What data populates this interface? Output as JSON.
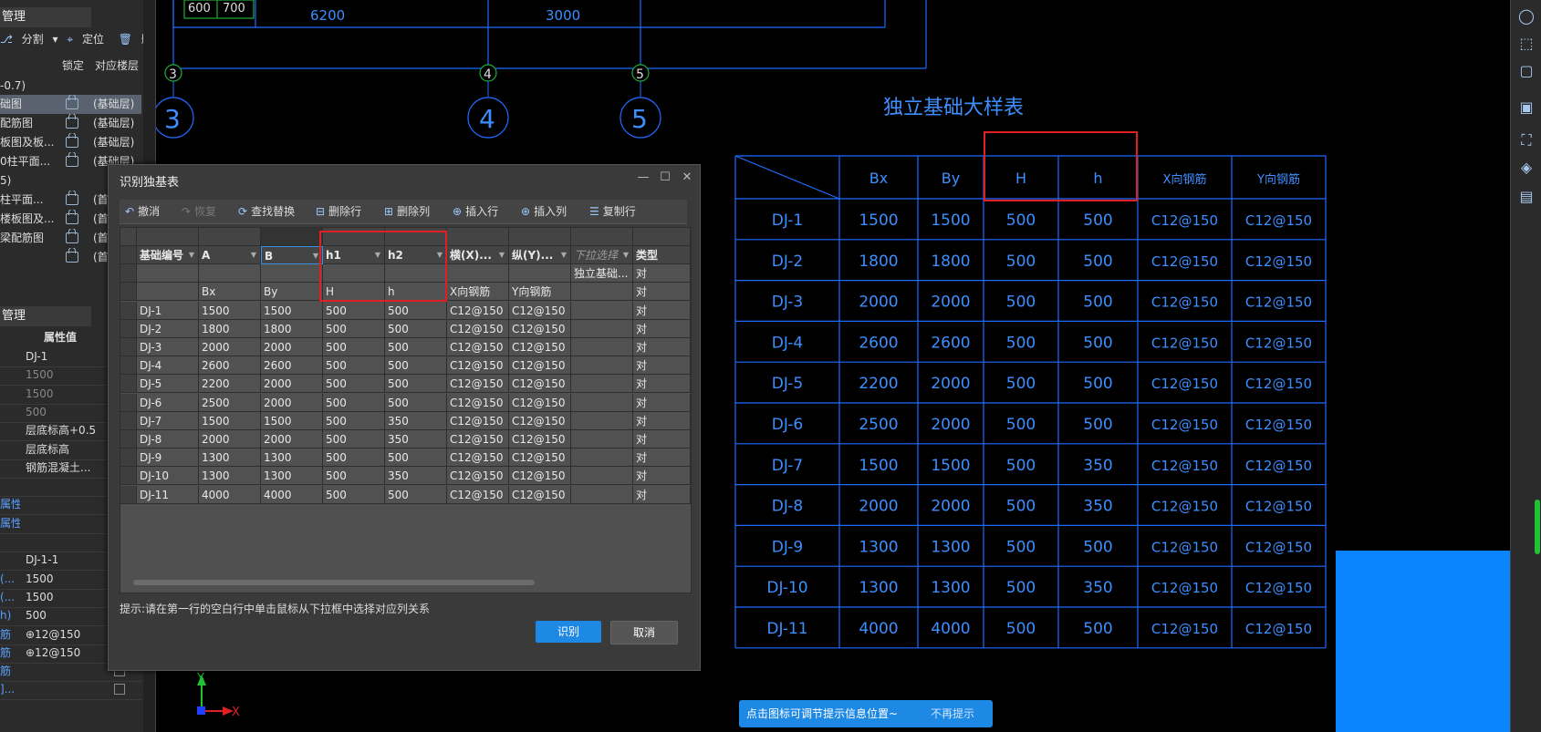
{
  "left_panel": {
    "title_top": "管理",
    "toolbar": {
      "split": "分割",
      "locate": "定位",
      "delete": "删除"
    },
    "col_headers": {
      "lock": "锁定",
      "floor": "对应楼层"
    },
    "group_label": "-0.7)",
    "drawings": [
      {
        "name": "础图",
        "floor": "(基础层)",
        "selected": true
      },
      {
        "name": "配筋图",
        "floor": "(基础层)"
      },
      {
        "name": "板图及板...",
        "floor": "(基础层)"
      },
      {
        "name": "0柱平面...",
        "floor": "(基础层)"
      },
      {
        "name": "5)",
        "floor": ""
      },
      {
        "name": "柱平面...",
        "floor": "(首"
      },
      {
        "name": "楼板图及...",
        "floor": "(首"
      },
      {
        "name": "梁配筋图",
        "floor": "(首"
      },
      {
        "name": "",
        "floor": "(首"
      }
    ],
    "title_bottom": "管理",
    "prop_header": "属性值",
    "properties": [
      {
        "key": "",
        "value": "DJ-1",
        "dim": false
      },
      {
        "key": "",
        "value": "1500",
        "dim": true
      },
      {
        "key": "",
        "value": "1500",
        "dim": true
      },
      {
        "key": "",
        "value": "500",
        "dim": true
      },
      {
        "key": "",
        "value": "层底标高+0.5",
        "dim": false
      },
      {
        "key": "",
        "value": "层底标高",
        "dim": false
      },
      {
        "key": "",
        "value": "钢筋混凝土...",
        "dim": false
      },
      {
        "key": "",
        "value": "",
        "dim": false
      },
      {
        "key": "属性",
        "value": "",
        "dim": false
      },
      {
        "key": "属性",
        "value": "",
        "dim": false
      },
      {
        "key": "",
        "value": "",
        "dim": false
      },
      {
        "key": "",
        "value": "DJ-1-1",
        "dim": false
      },
      {
        "key": "(...",
        "value": "1500",
        "dim": false
      },
      {
        "key": "(...",
        "value": "1500",
        "dim": false
      },
      {
        "key": "h)",
        "value": "500",
        "dim": false
      },
      {
        "key": "筋",
        "value": "⊕12@150",
        "dim": false,
        "check": true
      },
      {
        "key": "筋",
        "value": "⊕12@150",
        "dim": false,
        "check": true
      },
      {
        "key": "筋",
        "value": "",
        "dim": false,
        "check": true
      },
      {
        "key": "]...",
        "value": "",
        "dim": false,
        "check": true
      }
    ]
  },
  "cad": {
    "dims": [
      "600",
      "700",
      "6200",
      "3000"
    ],
    "axes": [
      "3",
      "4",
      "5"
    ],
    "table_title": "独立基础大样表",
    "table_headers": [
      "Bx",
      "By",
      "H",
      "h",
      "X向钢筋",
      "Y向钢筋"
    ],
    "rows": [
      [
        "DJ-1",
        "1500",
        "1500",
        "500",
        "500",
        "C12@150",
        "C12@150"
      ],
      [
        "DJ-2",
        "1800",
        "1800",
        "500",
        "500",
        "C12@150",
        "C12@150"
      ],
      [
        "DJ-3",
        "2000",
        "2000",
        "500",
        "500",
        "C12@150",
        "C12@150"
      ],
      [
        "DJ-4",
        "2600",
        "2600",
        "500",
        "500",
        "C12@150",
        "C12@150"
      ],
      [
        "DJ-5",
        "2200",
        "2000",
        "500",
        "500",
        "C12@150",
        "C12@150"
      ],
      [
        "DJ-6",
        "2500",
        "2000",
        "500",
        "500",
        "C12@150",
        "C12@150"
      ],
      [
        "DJ-7",
        "1500",
        "1500",
        "500",
        "350",
        "C12@150",
        "C12@150"
      ],
      [
        "DJ-8",
        "2000",
        "2000",
        "500",
        "350",
        "C12@150",
        "C12@150"
      ],
      [
        "DJ-9",
        "1300",
        "1300",
        "500",
        "500",
        "C12@150",
        "C12@150"
      ],
      [
        "DJ-10",
        "1300",
        "1300",
        "500",
        "350",
        "C12@150",
        "C12@150"
      ],
      [
        "DJ-11",
        "4000",
        "4000",
        "500",
        "500",
        "C12@150",
        "C12@150"
      ]
    ],
    "ucs_x": "X",
    "ucs_y": "Y"
  },
  "dialog": {
    "title": "识别独基表",
    "toolbar": {
      "undo": "撤消",
      "redo": "恢复",
      "find_replace": "查找替换",
      "delete_row": "删除行",
      "delete_col": "删除列",
      "insert_row": "插入行",
      "insert_col": "插入列",
      "copy_row": "复制行"
    },
    "grid": {
      "header_row": [
        "基础编号",
        "A",
        "B",
        "h1",
        "h2",
        "横(X)...",
        "纵(Y)...",
        "下拉选择",
        "类型"
      ],
      "type_row": [
        "",
        "",
        "",
        "",
        "",
        "",
        "",
        "独立基础...",
        "对"
      ],
      "label_row": [
        "",
        "Bx",
        "By",
        "H",
        "h",
        "X向钢筋",
        "Y向钢筋",
        "",
        "对"
      ],
      "rows": [
        [
          "DJ-1",
          "1500",
          "1500",
          "500",
          "500",
          "C12@150",
          "C12@150",
          "",
          "对"
        ],
        [
          "DJ-2",
          "1800",
          "1800",
          "500",
          "500",
          "C12@150",
          "C12@150",
          "",
          "对"
        ],
        [
          "DJ-3",
          "2000",
          "2000",
          "500",
          "500",
          "C12@150",
          "C12@150",
          "",
          "对"
        ],
        [
          "DJ-4",
          "2600",
          "2600",
          "500",
          "500",
          "C12@150",
          "C12@150",
          "",
          "对"
        ],
        [
          "DJ-5",
          "2200",
          "2000",
          "500",
          "500",
          "C12@150",
          "C12@150",
          "",
          "对"
        ],
        [
          "DJ-6",
          "2500",
          "2000",
          "500",
          "500",
          "C12@150",
          "C12@150",
          "",
          "对"
        ],
        [
          "DJ-7",
          "1500",
          "1500",
          "500",
          "350",
          "C12@150",
          "C12@150",
          "",
          "对"
        ],
        [
          "DJ-8",
          "2000",
          "2000",
          "500",
          "350",
          "C12@150",
          "C12@150",
          "",
          "对"
        ],
        [
          "DJ-9",
          "1300",
          "1300",
          "500",
          "500",
          "C12@150",
          "C12@150",
          "",
          "对"
        ],
        [
          "DJ-10",
          "1300",
          "1300",
          "500",
          "350",
          "C12@150",
          "C12@150",
          "",
          "对"
        ],
        [
          "DJ-11",
          "4000",
          "4000",
          "500",
          "500",
          "C12@150",
          "C12@150",
          "",
          "对"
        ]
      ]
    },
    "tip": "提示:请在第一行的空白行中单击鼠标从下拉框中选择对应列关系",
    "ok": "识别",
    "cancel": "取消"
  },
  "tip_bar": {
    "message": "点击图标可调节提示信息位置~",
    "dismiss": "不再提示"
  },
  "colors": {
    "cad_line": "#1e6bff",
    "cad_text": "#3d8fff",
    "accent": "#1e88e5",
    "highlight": "#e02020"
  }
}
